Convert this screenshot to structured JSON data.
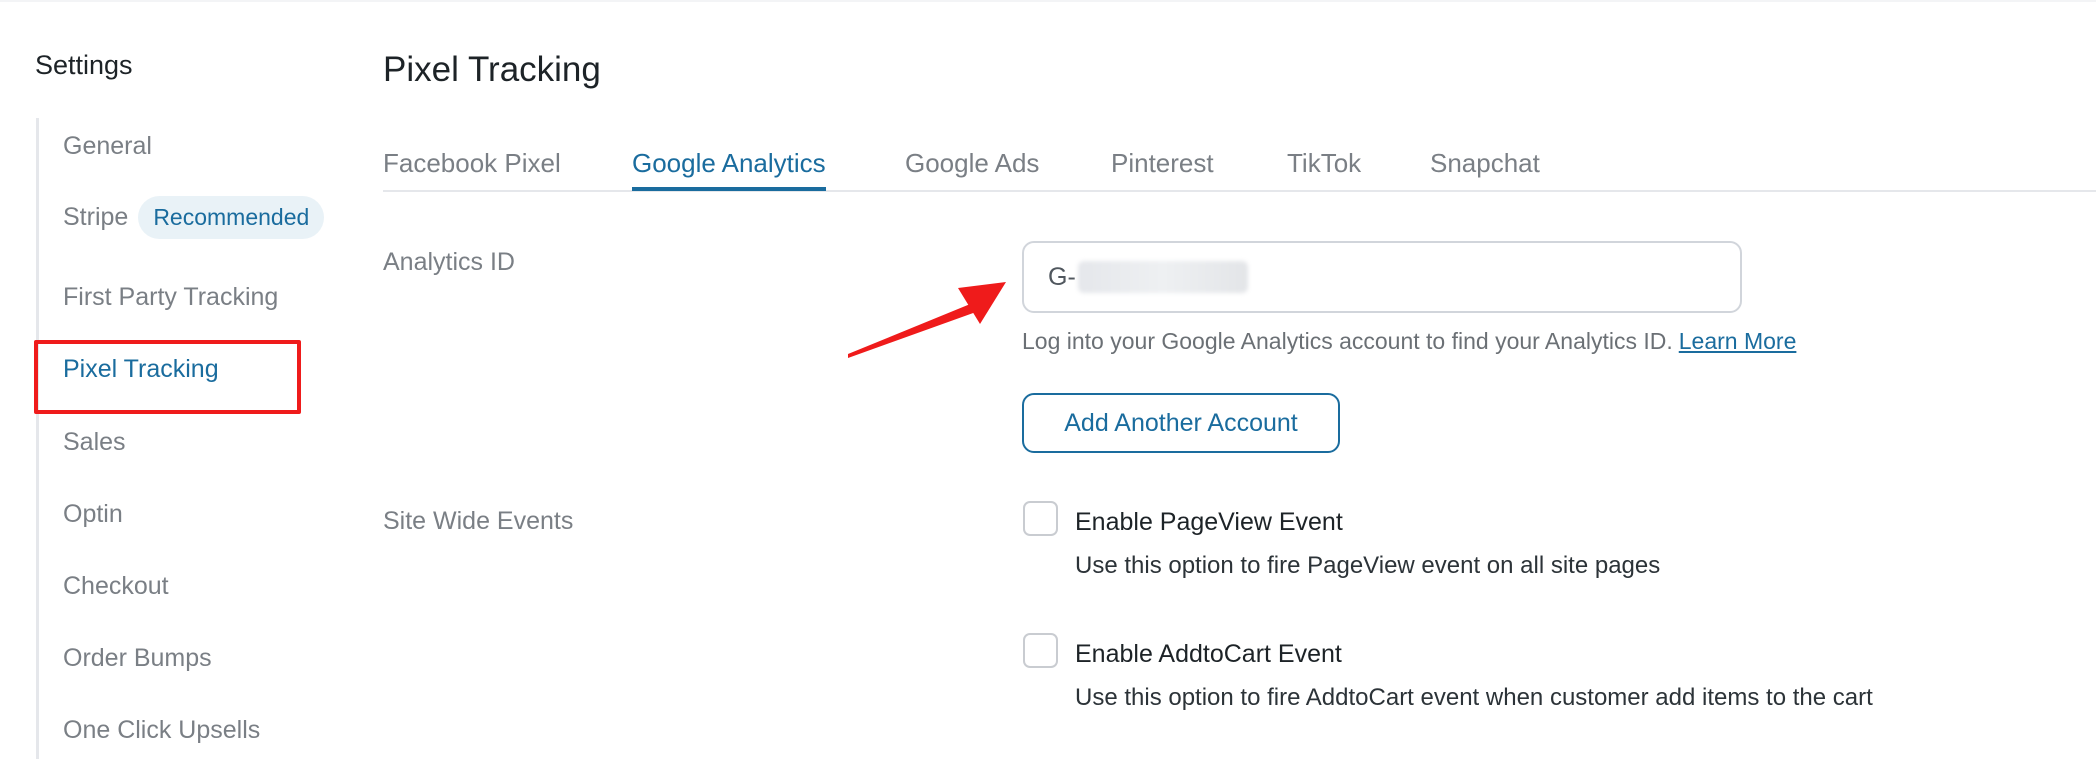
{
  "sidebar": {
    "title": "Settings",
    "items": [
      {
        "label": "General"
      },
      {
        "label": "Stripe",
        "badge": "Recommended"
      },
      {
        "label": "First Party Tracking"
      },
      {
        "label": "Pixel Tracking",
        "active": true
      },
      {
        "label": "Sales"
      },
      {
        "label": "Optin"
      },
      {
        "label": "Checkout"
      },
      {
        "label": "Order Bumps"
      },
      {
        "label": "One Click Upsells"
      }
    ]
  },
  "main": {
    "title": "Pixel Tracking",
    "tabs": [
      {
        "label": "Facebook Pixel"
      },
      {
        "label": "Google Analytics",
        "active": true
      },
      {
        "label": "Google Ads"
      },
      {
        "label": "Pinterest"
      },
      {
        "label": "TikTok"
      },
      {
        "label": "Snapchat"
      }
    ],
    "analytics": {
      "label": "Analytics ID",
      "value_prefix": "G-",
      "help_text": "Log into your Google Analytics account to find your Analytics ID.",
      "learn_more": "Learn More",
      "add_button": "Add Another Account"
    },
    "site_wide": {
      "label": "Site Wide Events",
      "events": [
        {
          "title": "Enable PageView Event",
          "description": "Use this option to fire PageView event on all site pages",
          "checked": false
        },
        {
          "title": "Enable AddtoCart Event",
          "description": "Use this option to fire AddtoCart event when customer add items to the cart",
          "checked": false
        }
      ]
    }
  },
  "colors": {
    "accent": "#1a6c9e",
    "highlight": "#ef1b1b",
    "muted_text": "#7a7f85",
    "badge_bg": "#e9f2f7"
  }
}
